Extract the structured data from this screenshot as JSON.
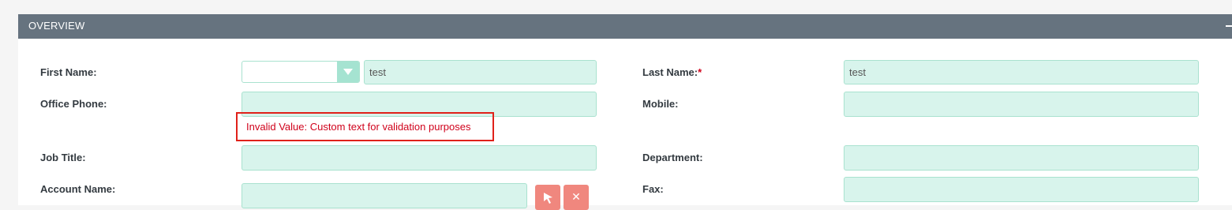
{
  "panel": {
    "title": "OVERVIEW"
  },
  "fields": {
    "first_name": {
      "label": "First Name:",
      "value": "test",
      "salutation_value": ""
    },
    "last_name": {
      "label": "Last Name:",
      "required_marker": "*",
      "value": "test"
    },
    "office_phone": {
      "label": "Office Phone:",
      "value": ""
    },
    "mobile": {
      "label": "Mobile:",
      "value": ""
    },
    "job_title": {
      "label": "Job Title:",
      "value": ""
    },
    "department": {
      "label": "Department:",
      "value": ""
    },
    "account_name": {
      "label": "Account Name:",
      "value": ""
    },
    "fax": {
      "label": "Fax:",
      "value": ""
    }
  },
  "validation": {
    "message": "Invalid Value: Custom text for validation purposes"
  },
  "icons": {
    "select_account": "cursor-arrow-icon",
    "clear_account": "close-icon"
  },
  "colors": {
    "header": "#66737f",
    "field_bg": "#d8f4ec",
    "error": "#d0021b",
    "action_button": "#f0877e"
  }
}
